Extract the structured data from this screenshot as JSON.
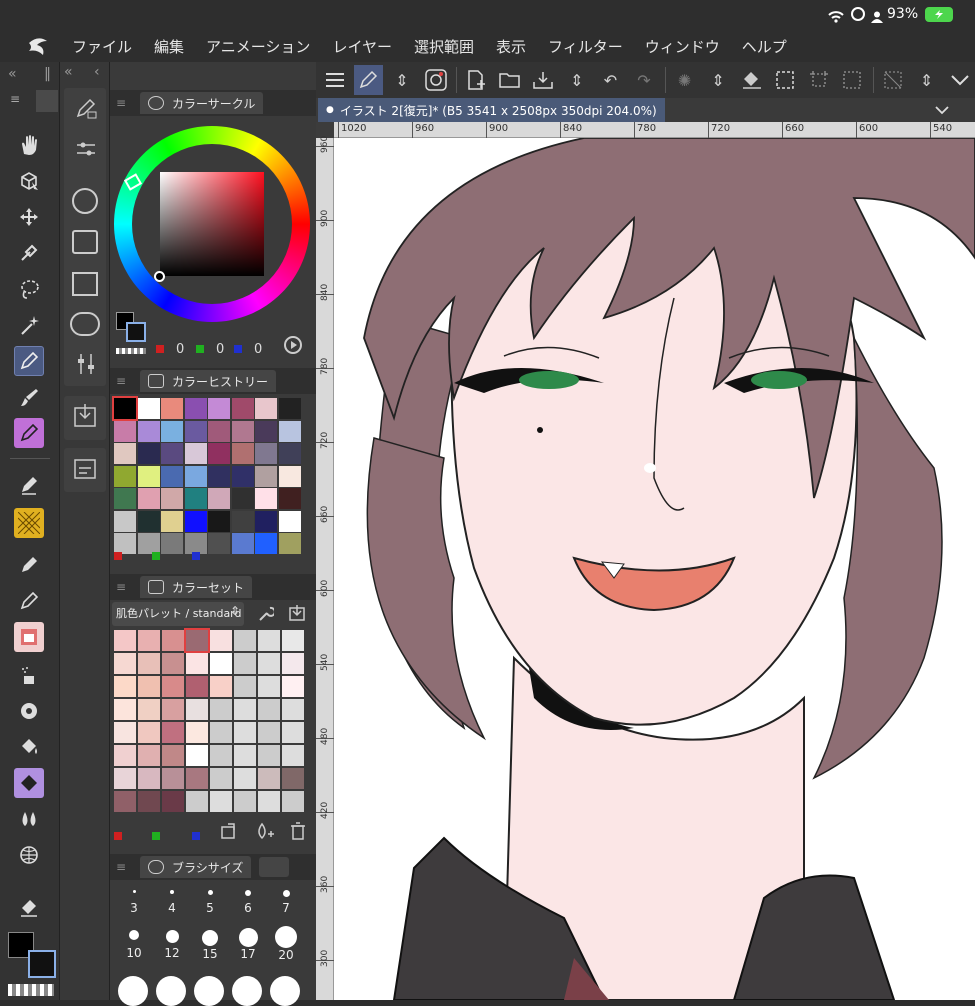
{
  "status": {
    "battery": "93%"
  },
  "menu": [
    "ファイル",
    "編集",
    "アニメーション",
    "レイヤー",
    "選択範囲",
    "表示",
    "フィルター",
    "ウィンドウ",
    "ヘルプ"
  ],
  "panels": {
    "color_circle": {
      "title": "カラーサークル",
      "r": "0",
      "g": "0",
      "b": "0"
    },
    "color_history": {
      "title": "カラーヒストリー"
    },
    "color_set": {
      "title": "カラーセット",
      "palette": "肌色パレット / standard"
    },
    "brush_size": {
      "title": "ブラシサイズ",
      "sizes": [
        "3",
        "4",
        "5",
        "6",
        "7",
        "10",
        "12",
        "15",
        "17",
        "20"
      ]
    }
  },
  "document": {
    "tab": "イラスト 2[復元]* (B5 3541 x 2508px 350dpi 204.0%)"
  },
  "ruler": {
    "h": [
      "1020",
      "960",
      "900",
      "840",
      "780",
      "720",
      "660",
      "600",
      "540"
    ],
    "v": [
      "960",
      "900",
      "840",
      "780",
      "720",
      "660",
      "600",
      "540",
      "480",
      "420",
      "360",
      "300"
    ]
  },
  "colors": {
    "history": [
      "#000000",
      "#ffffff",
      "#e98a7c",
      "#8a4fb0",
      "#c48ad6",
      "#a04a6a",
      "#e8c6cc",
      "#222222",
      "#c87ca8",
      "#a98ad8",
      "#7ab0e0",
      "#6a5aa0",
      "#a05a7a",
      "#b07890",
      "#4a3a5a",
      "#b8c4e0",
      "#e0c8c0",
      "#2a2a50",
      "#5a4a80",
      "#d8c8d8",
      "#903060",
      "#b07070",
      "#807890",
      "#404058",
      "#90a830",
      "#e0f080",
      "#4a6ab0",
      "#7aa8e0",
      "#303060",
      "#303068",
      "#b0a0a0",
      "#f8e8e0",
      "#407850",
      "#e0a0b0",
      "#d0a8a8",
      "#208080",
      "#d0a8b8",
      "#303030",
      "#ffe0e8",
      "#402020",
      "#c8c8c8",
      "#203030",
      "#e0d090",
      "#1010ff",
      "#181818",
      "#404040",
      "#202060",
      "#ffffff",
      "#c0c0c0",
      "#a0a0a0",
      "#7a7a7a",
      "#8a8a8a",
      "#505050",
      "#5a7ad0",
      "#2060ff",
      "#a0a060"
    ],
    "skin": [
      "#f4c7c7",
      "#e8b0b0",
      "#d89090",
      "#9a6a72",
      "#f8e0e0",
      "#cccccc",
      "#dddddd",
      "#e8e8e8",
      "#f6d8d2",
      "#e8c0b8",
      "#c89090",
      "#fbe4e4",
      "#ffffff",
      "#cccccc",
      "#dddddd",
      "#f4e8ec",
      "#fcd9c8",
      "#f0c0b0",
      "#d88a8a",
      "#b06070",
      "#f8d0c8",
      "#cccccc",
      "#dddddd",
      "#fff0f2",
      "#fce4dc",
      "#f0d0c4",
      "#d8a0a0",
      "#e8e0e0",
      "#cccccc",
      "#dddddd",
      "#cccccc",
      "#dddddd",
      "#f8e4e0",
      "#f0c8c0",
      "#c07080",
      "#fce8e0",
      "#cccccc",
      "#dddddd",
      "#cccccc",
      "#dddddd",
      "#f0d0d0",
      "#e0b0b0",
      "#c08888",
      "#ffffff",
      "#cccccc",
      "#dddddd",
      "#cccccc",
      "#dddddd",
      "#e8d4d8",
      "#d8b8c0",
      "#b89098",
      "#a87880",
      "#cccccc",
      "#dddddd",
      "#ccbbbb",
      "#806868",
      "#906068",
      "#704850",
      "#6a3a48",
      "#cccccc",
      "#dddddd",
      "#cccccc",
      "#dddddd",
      "#cccccc"
    ]
  }
}
